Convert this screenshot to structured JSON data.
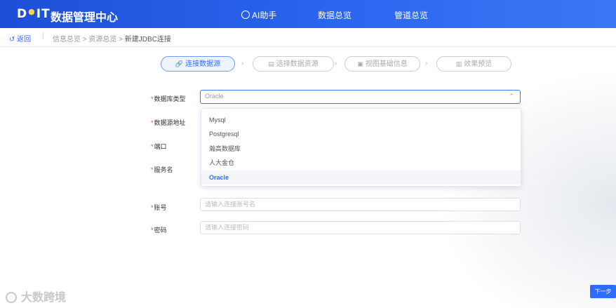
{
  "header": {
    "logo": "DIT",
    "app_title": "数据管理中心",
    "nav": [
      "AI助手",
      "数据总览",
      "管道总览"
    ]
  },
  "breadcrumb": {
    "back_label": "返回",
    "separator": "|",
    "path": "信息总览 > 资源总览 > ",
    "current": "新建JDBC连接"
  },
  "steps": [
    {
      "label": "连接数据源",
      "icon": "link-icon",
      "active": true
    },
    {
      "label": "选择数据资源",
      "icon": "document-icon",
      "active": false
    },
    {
      "label": "视图基础信息",
      "icon": "image-icon",
      "active": false
    },
    {
      "label": "效果预览",
      "icon": "preview-icon",
      "active": false
    }
  ],
  "form": {
    "db_type_label": "数据库类型",
    "db_type_value": "Oracle",
    "address_label": "数据源地址",
    "port_label": "端口",
    "service_label": "服务名",
    "account_label": "账号",
    "account_placeholder": "请输入连接账号名",
    "password_label": "密码",
    "password_placeholder": "请输入连接密码"
  },
  "dropdown": {
    "options": [
      "Mysql",
      "Postgresql",
      "瀚高数据库",
      "人大金仓",
      "Oracle"
    ],
    "selected": "Oracle"
  },
  "footer": {
    "next_label": "下一步",
    "watermark": "大数跨境"
  },
  "colors": {
    "primary": "#2f6bff",
    "header_bg": "#1d4fd6",
    "required": "#e24a4a"
  }
}
